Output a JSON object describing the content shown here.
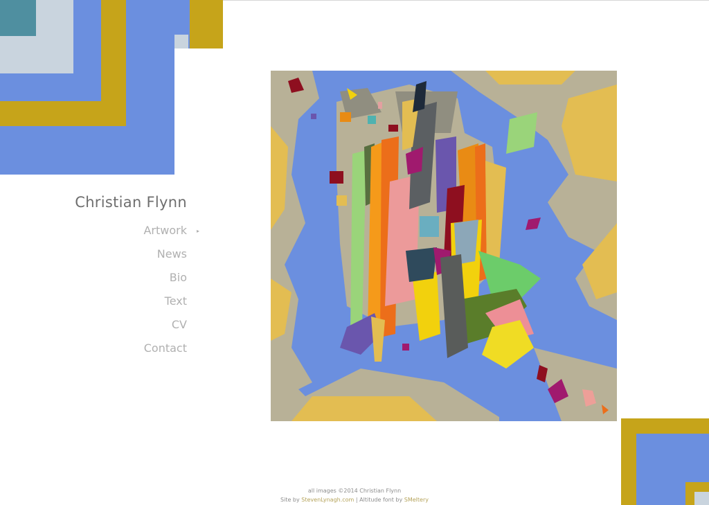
{
  "site": {
    "title": "Christian Flynn"
  },
  "nav": {
    "items": [
      {
        "label": "Artwork",
        "active": true
      },
      {
        "label": "News"
      },
      {
        "label": "Bio"
      },
      {
        "label": "Text"
      },
      {
        "label": "CV"
      },
      {
        "label": "Contact"
      }
    ],
    "active_indicator": "▸"
  },
  "footer": {
    "copyright": "all images ©2014 Christian Flynn",
    "site_by_prefix": "Site by ",
    "site_by_link": "StevenLynagh.com",
    "separator": " | ",
    "font_prefix": "Altitude font by ",
    "font_link": "SMeltery"
  },
  "colors": {
    "blue": "#6b8fdf",
    "mustard": "#c6a41a",
    "sand": "#b8b197",
    "pale": "#c9d4de",
    "teal": "#4f8fa0",
    "link": "#b5a35a"
  }
}
